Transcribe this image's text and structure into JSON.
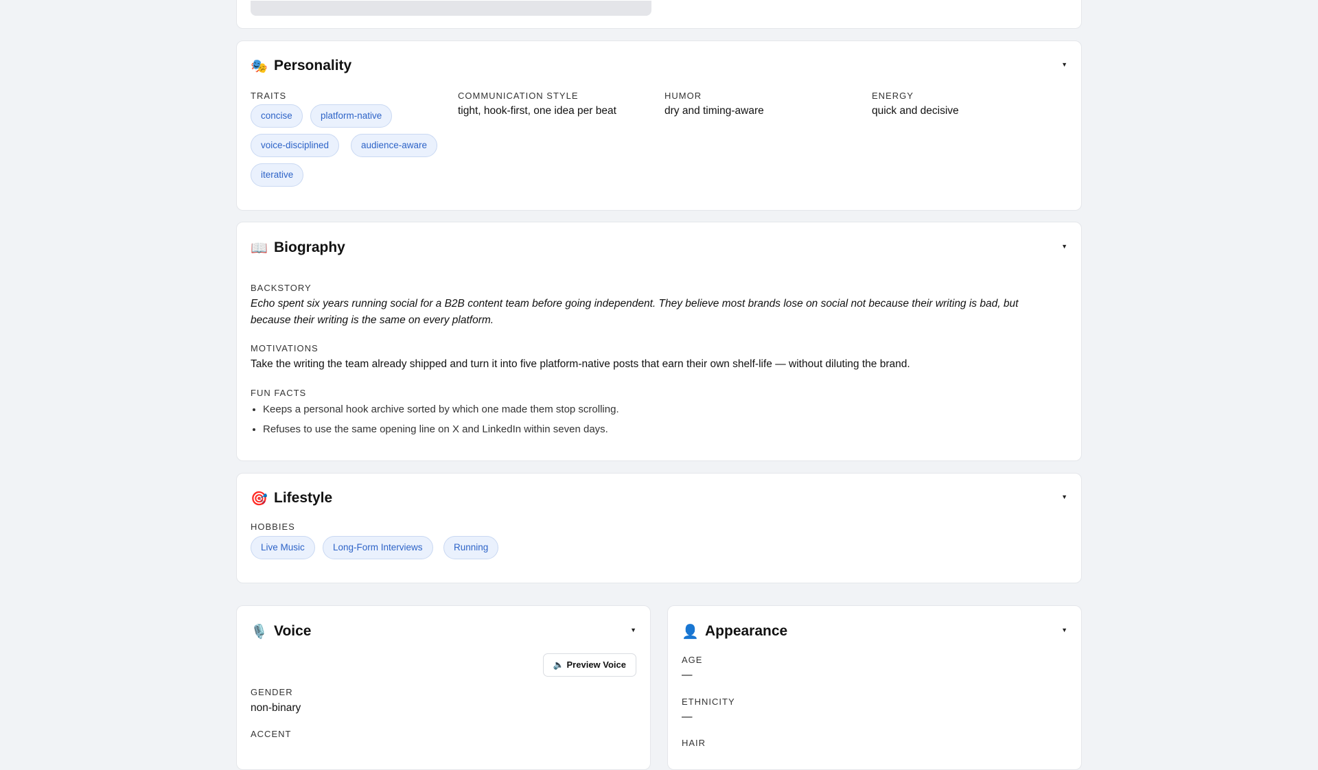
{
  "personality": {
    "title": "Personality",
    "icon": "theater-masks-icon",
    "traits_label": "TRAITS",
    "traits": [
      "concise",
      "platform-native",
      "voice-disciplined",
      "audience-aware",
      "iterative"
    ],
    "communication_label": "COMMUNICATION STYLE",
    "communication_value": "tight, hook-first, one idea per beat",
    "humor_label": "HUMOR",
    "humor_value": "dry and timing-aware",
    "energy_label": "ENERGY",
    "energy_value": "quick and decisive"
  },
  "biography": {
    "title": "Biography",
    "icon": "open-book-icon",
    "backstory_label": "BACKSTORY",
    "backstory": "Echo spent six years running social for a B2B content team before going independent. They believe most brands lose on social not because their writing is bad, but because their writing is the same on every platform.",
    "motivations_label": "MOTIVATIONS",
    "motivations": "Take the writing the team already shipped and turn it into five platform-native posts that earn their own shelf-life — without diluting the brand.",
    "fun_facts_label": "FUN FACTS",
    "fun_facts": [
      "Keeps a personal hook archive sorted by which one made them stop scrolling.",
      "Refuses to use the same opening line on X and LinkedIn within seven days."
    ]
  },
  "lifestyle": {
    "title": "Lifestyle",
    "icon": "target-dart-icon",
    "hobbies_label": "HOBBIES",
    "hobbies": [
      "Live Music",
      "Long-Form Interviews",
      "Running"
    ]
  },
  "voice": {
    "title": "Voice",
    "icon": "microphone-icon",
    "preview_button": "Preview Voice",
    "preview_icon": "speaker-icon",
    "gender_label": "GENDER",
    "gender_value": "non-binary",
    "accent_label": "ACCENT"
  },
  "appearance": {
    "title": "Appearance",
    "icon": "person-silhouette-icon",
    "age_label": "AGE",
    "age_value": "—",
    "ethnicity_label": "ETHNICITY",
    "ethnicity_value": "—",
    "hair_label": "HAIR"
  },
  "colors": {
    "chip_bg": "#eaf1fd",
    "chip_text": "#2d63c7",
    "page_bg": "#f1f3f6"
  }
}
